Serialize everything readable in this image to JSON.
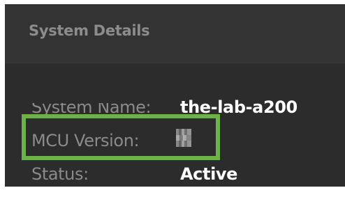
{
  "panel": {
    "title": "System Details"
  },
  "details": {
    "system_name_label": "System Name:",
    "system_name_value": "the-lab-a200",
    "mcu_version_label": "MCU Version:",
    "status_label": "Status:",
    "status_value": "Active"
  },
  "colors": {
    "highlight": "#6cb24a",
    "panel_background": "#2c2c2c",
    "label_text": "#8b8b8b",
    "value_text": "#ffffff"
  }
}
